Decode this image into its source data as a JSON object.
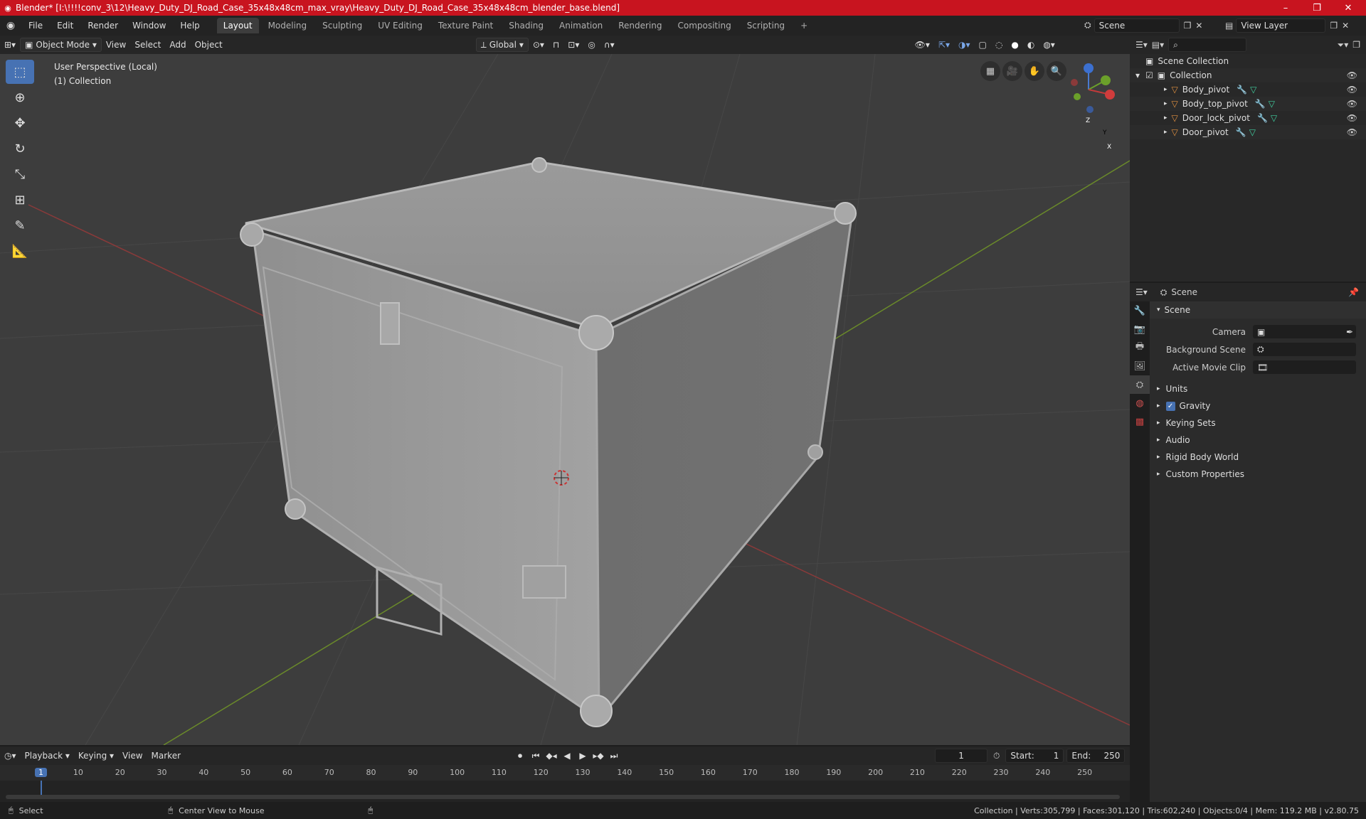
{
  "title": "Blender* [I:\\!!!!conv_3\\12\\Heavy_Duty_DJ_Road_Case_35x48x48cm_max_vray\\Heavy_Duty_DJ_Road_Case_35x48x48cm_blender_base.blend]",
  "menu": [
    "File",
    "Edit",
    "Render",
    "Window",
    "Help"
  ],
  "workspaces": [
    "Layout",
    "Modeling",
    "Sculpting",
    "UV Editing",
    "Texture Paint",
    "Shading",
    "Animation",
    "Rendering",
    "Compositing",
    "Scripting"
  ],
  "active_workspace": "Layout",
  "scene_name": "Scene",
  "view_layer": "View Layer",
  "viewport": {
    "mode": "Object Mode",
    "menus": [
      "View",
      "Select",
      "Add",
      "Object"
    ],
    "orientation": "Global",
    "info_line1": "User Perspective (Local)",
    "info_line2": "(1) Collection",
    "gizmo": {
      "x": "X",
      "y": "Y",
      "z": "Z"
    }
  },
  "outliner": {
    "root": "Scene Collection",
    "collection": "Collection",
    "items": [
      "Body_pivot",
      "Body_top_pivot",
      "Door_lock_pivot",
      "Door_pivot"
    ]
  },
  "properties": {
    "header": "Scene",
    "panel": "Scene",
    "camera_label": "Camera",
    "bg_scene_label": "Background Scene",
    "movie_clip_label": "Active Movie Clip",
    "sections": [
      "Units",
      "Gravity",
      "Keying Sets",
      "Audio",
      "Rigid Body World",
      "Custom Properties"
    ]
  },
  "timeline": {
    "menus": [
      "Playback",
      "Keying",
      "View",
      "Marker"
    ],
    "current_frame": "1",
    "start_label": "Start:",
    "start": "1",
    "end_label": "End:",
    "end": "250",
    "ticks": [
      "1",
      "10",
      "20",
      "30",
      "40",
      "50",
      "60",
      "70",
      "80",
      "90",
      "100",
      "110",
      "120",
      "130",
      "140",
      "150",
      "160",
      "170",
      "180",
      "190",
      "200",
      "210",
      "220",
      "230",
      "240",
      "250"
    ]
  },
  "status": {
    "left": "Select",
    "middle": "Center View to Mouse",
    "stats": "Collection | Verts:305,799 | Faces:301,120 | Tris:602,240 | Objects:0/4 | Mem: 119.2 MB | v2.80.75"
  }
}
